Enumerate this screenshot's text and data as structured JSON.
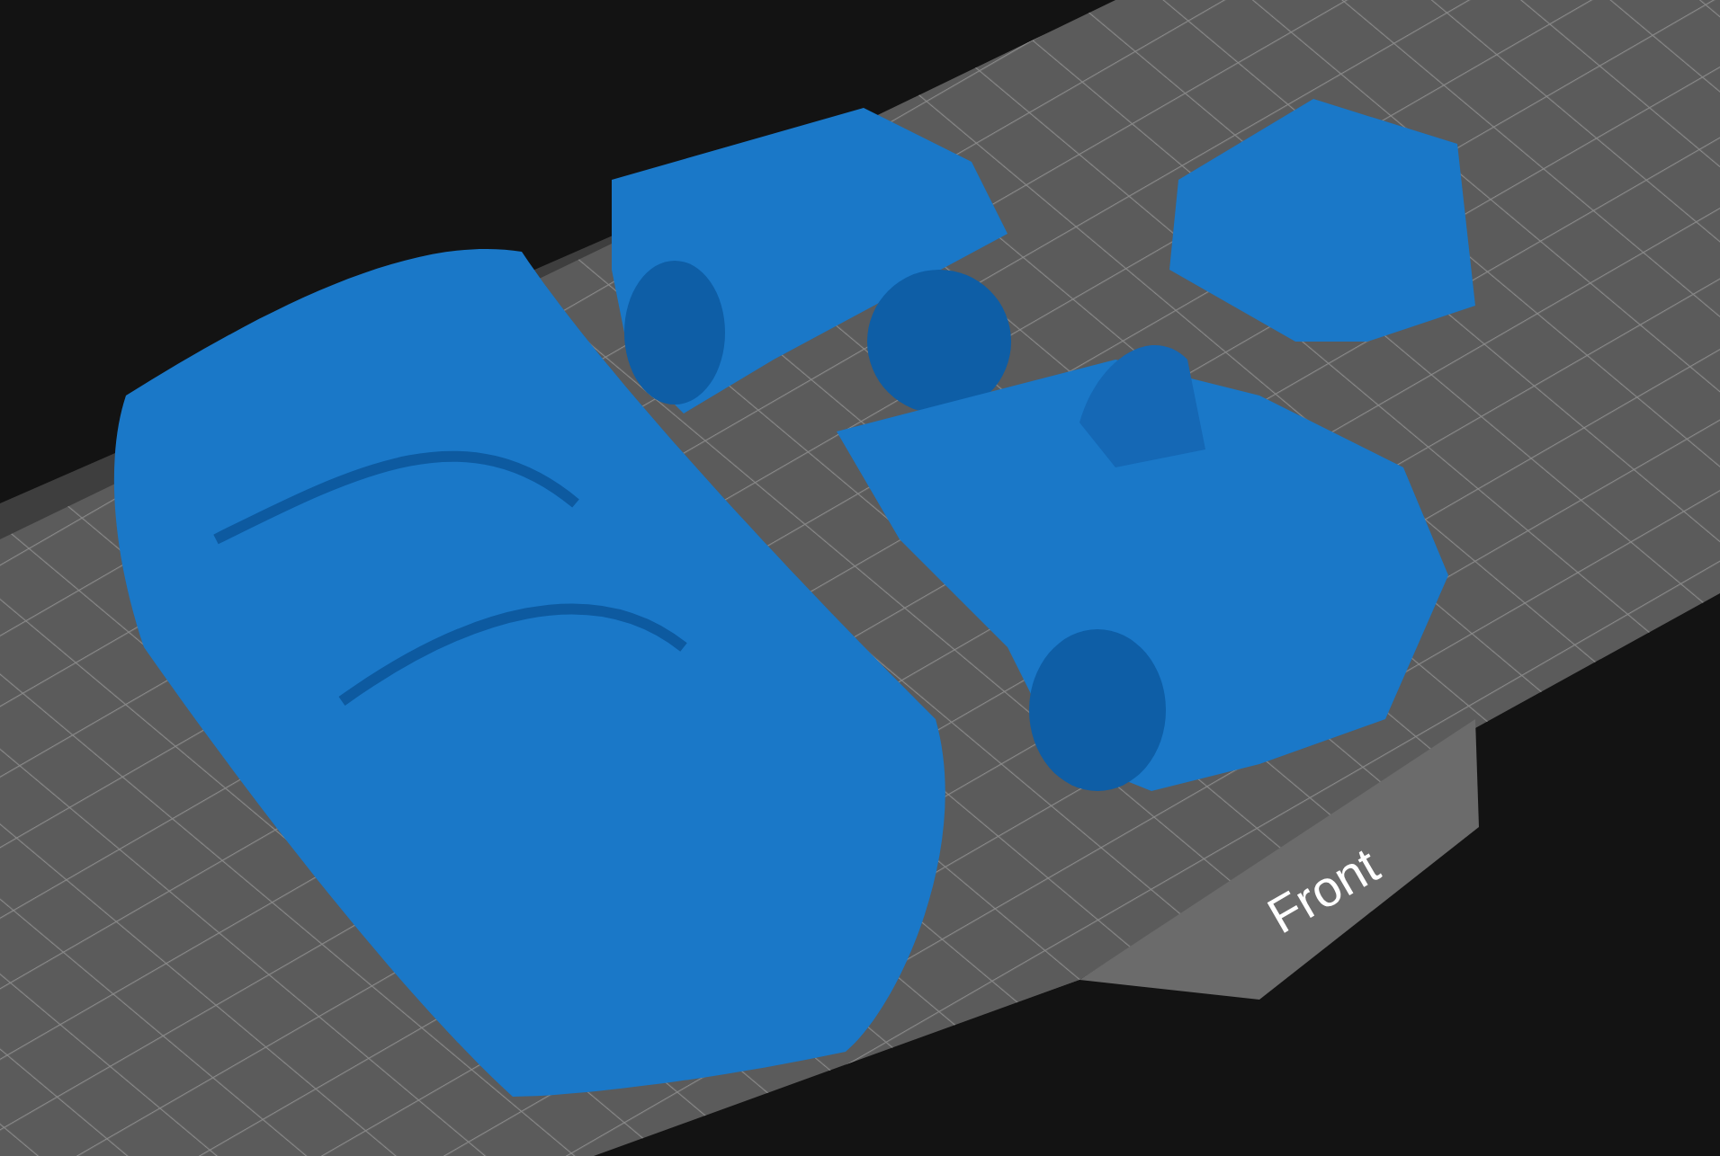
{
  "plate": {
    "front_label": "Front"
  }
}
